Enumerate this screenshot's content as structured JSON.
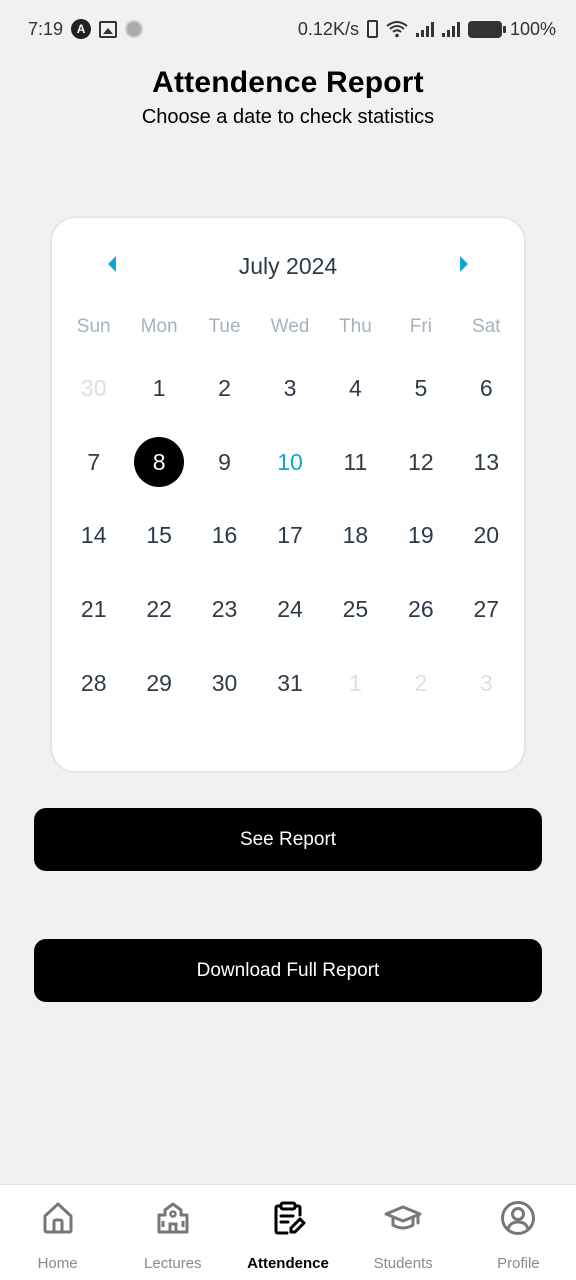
{
  "status_bar": {
    "time": "7:19",
    "network_speed": "0.12K/s",
    "battery": "100%"
  },
  "header": {
    "title": "Attendence Report",
    "subtitle": "Choose a date to check statistics"
  },
  "calendar": {
    "month_label": "July 2024",
    "weekdays": [
      "Sun",
      "Mon",
      "Tue",
      "Wed",
      "Thu",
      "Fri",
      "Sat"
    ],
    "days": [
      {
        "label": "30",
        "state": "muted"
      },
      {
        "label": "1",
        "state": "normal"
      },
      {
        "label": "2",
        "state": "normal"
      },
      {
        "label": "3",
        "state": "normal"
      },
      {
        "label": "4",
        "state": "normal"
      },
      {
        "label": "5",
        "state": "normal"
      },
      {
        "label": "6",
        "state": "normal"
      },
      {
        "label": "7",
        "state": "normal"
      },
      {
        "label": "8",
        "state": "selected"
      },
      {
        "label": "9",
        "state": "normal"
      },
      {
        "label": "10",
        "state": "today"
      },
      {
        "label": "11",
        "state": "normal"
      },
      {
        "label": "12",
        "state": "normal"
      },
      {
        "label": "13",
        "state": "normal"
      },
      {
        "label": "14",
        "state": "normal"
      },
      {
        "label": "15",
        "state": "normal"
      },
      {
        "label": "16",
        "state": "normal"
      },
      {
        "label": "17",
        "state": "normal"
      },
      {
        "label": "18",
        "state": "normal"
      },
      {
        "label": "19",
        "state": "normal"
      },
      {
        "label": "20",
        "state": "normal"
      },
      {
        "label": "21",
        "state": "normal"
      },
      {
        "label": "22",
        "state": "normal"
      },
      {
        "label": "23",
        "state": "normal"
      },
      {
        "label": "24",
        "state": "normal"
      },
      {
        "label": "25",
        "state": "normal"
      },
      {
        "label": "26",
        "state": "normal"
      },
      {
        "label": "27",
        "state": "normal"
      },
      {
        "label": "28",
        "state": "normal"
      },
      {
        "label": "29",
        "state": "normal"
      },
      {
        "label": "30",
        "state": "normal"
      },
      {
        "label": "31",
        "state": "normal"
      },
      {
        "label": "1",
        "state": "muted"
      },
      {
        "label": "2",
        "state": "muted"
      },
      {
        "label": "3",
        "state": "muted"
      }
    ],
    "accent_color": "#0ea5d8"
  },
  "buttons": {
    "see_report": "See Report",
    "download_full_report": "Download Full Report"
  },
  "bottom_nav": {
    "items": [
      {
        "label": "Home",
        "icon": "home-icon",
        "active": false
      },
      {
        "label": "Lectures",
        "icon": "school-building-icon",
        "active": false
      },
      {
        "label": "Attendence",
        "icon": "clipboard-edit-icon",
        "active": true
      },
      {
        "label": "Students",
        "icon": "graduation-cap-icon",
        "active": false
      },
      {
        "label": "Profile",
        "icon": "user-circle-icon",
        "active": false
      }
    ]
  }
}
